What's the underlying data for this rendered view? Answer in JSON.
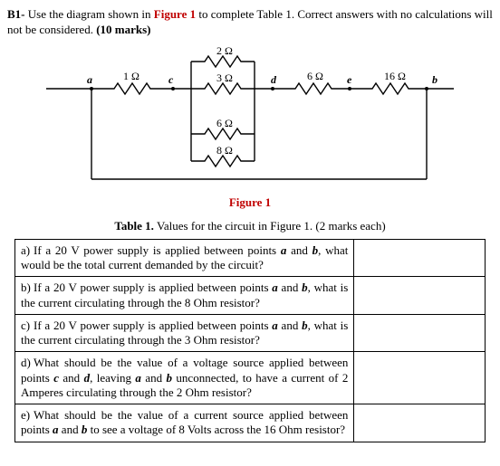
{
  "prompt": {
    "label": "B1-",
    "text_part1": " Use the diagram shown in ",
    "fig_ref": "Figure 1",
    "text_part2": " to complete Table 1. Correct answers with no calculations will not be considered. ",
    "marks": "(10 marks)"
  },
  "circuit": {
    "nodes": {
      "a": "a",
      "c": "c",
      "d": "d",
      "e": "e",
      "b": "b"
    },
    "resistors": {
      "r_ac": "1 Ω",
      "r_top": "2 Ω",
      "r_mid": "3 Ω",
      "r_bot1": "6 Ω",
      "r_bot2": "8 Ω",
      "r_de": "6 Ω",
      "r_eb": "16 Ω"
    }
  },
  "figure_caption": "Figure 1",
  "table_caption_bold": "Table 1.",
  "table_caption_rest": " Values for the circuit in Figure 1. (2 marks each)",
  "rows": [
    {
      "label": "a)",
      "pre": "If a 20 V power supply is applied between points ",
      "i1": "a",
      "mid1": " and ",
      "i2": "b",
      "post": ", what would be the total current demanded by the circuit?"
    },
    {
      "label": "b)",
      "pre": "If a 20 V power supply is applied between points ",
      "i1": "a",
      "mid1": " and ",
      "i2": "b",
      "post": ", what is the current circulating through the 8 Ohm resistor?"
    },
    {
      "label": "c)",
      "pre": "If a 20 V power supply is applied between points ",
      "i1": "a",
      "mid1": " and ",
      "i2": "b",
      "post": ", what is the current circulating through the 3 Ohm resistor?"
    },
    {
      "label": "d)",
      "pre": "What should be the value of a voltage source applied between points ",
      "i1": "c",
      "mid1": " and ",
      "i2": "d",
      "mid2": ", leaving ",
      "i3": "a",
      "mid3": " and ",
      "i4": "b",
      "post": " unconnected, to have a current of 2 Amperes circulating through the 2 Ohm resistor?"
    },
    {
      "label": "e)",
      "pre": "What should be the value of a current source applied between points ",
      "i1": "a",
      "mid1": " and ",
      "i2": "b",
      "post": " to see a voltage of 8 Volts across the 16 Ohm resistor?"
    }
  ]
}
